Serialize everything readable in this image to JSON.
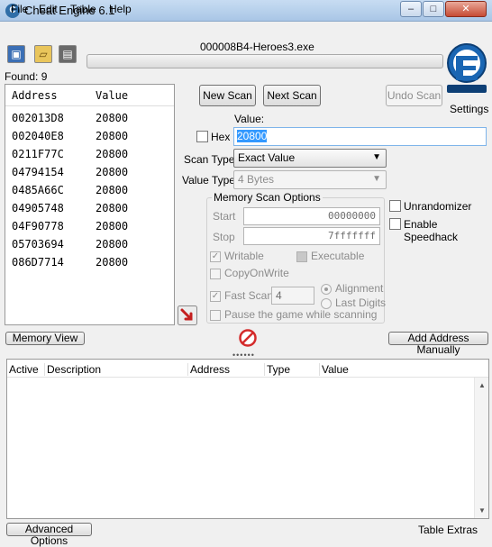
{
  "window": {
    "title": "Cheat Engine 6.1",
    "min_glyph": "–",
    "max_glyph": "□",
    "close_glyph": "✕"
  },
  "menu": [
    "File",
    "Edit",
    "Table",
    "Help"
  ],
  "process": {
    "title": "000008B4-Heroes3.exe"
  },
  "settings_label": "Settings",
  "found_label": "Found: 9",
  "results": {
    "headers": {
      "address": "Address",
      "value": "Value"
    },
    "rows": [
      {
        "address": "002013D8",
        "value": "20800"
      },
      {
        "address": "002040E8",
        "value": "20800"
      },
      {
        "address": "0211F77C",
        "value": "20800"
      },
      {
        "address": "04794154",
        "value": "20800"
      },
      {
        "address": "0485A66C",
        "value": "20800"
      },
      {
        "address": "04905748",
        "value": "20800"
      },
      {
        "address": "04F90778",
        "value": "20800"
      },
      {
        "address": "05703694",
        "value": "20800"
      },
      {
        "address": "086D7714",
        "value": "20800"
      }
    ]
  },
  "scan": {
    "new_scan": "New Scan",
    "next_scan": "Next Scan",
    "undo_scan": "Undo Scan",
    "value_label": "Value:",
    "hex_label": "Hex",
    "value": "20800",
    "scan_type_label": "Scan Type",
    "scan_type": "Exact Value",
    "value_type_label": "Value Type",
    "value_type": "4 Bytes"
  },
  "memory_options": {
    "title": "Memory Scan Options",
    "start_label": "Start",
    "start_value": "00000000",
    "stop_label": "Stop",
    "stop_value": "7fffffff",
    "writable_label": "Writable",
    "executable_label": "Executable",
    "copyonwrite_label": "CopyOnWrite",
    "fastscan_label": "Fast Scan",
    "fastscan_value": "4",
    "alignment_label": "Alignment",
    "lastdigits_label": "Last Digits",
    "pause_label": "Pause the game while scanning"
  },
  "side_options": {
    "unrandomizer_label": "Unrandomizer",
    "speedhack_label": "Enable Speedhack"
  },
  "buttons": {
    "memory_view": "Memory View",
    "add_address": "Add Address Manually",
    "advanced_options": "Advanced Options",
    "table_extras": "Table Extras"
  },
  "address_table": {
    "headers": {
      "active": "Active",
      "description": "Description",
      "address": "Address",
      "type": "Type",
      "value": "Value"
    }
  },
  "colors": {
    "accent_selection": "#3399ff",
    "stop_icon_red": "#d42b2b",
    "logo_blue": "#1a66b3"
  }
}
